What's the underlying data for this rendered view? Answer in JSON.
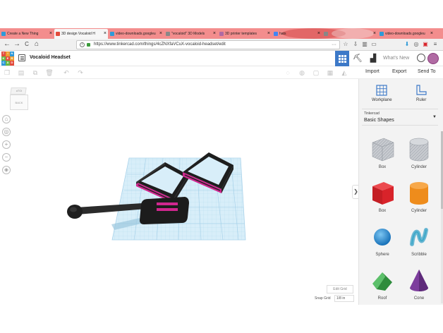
{
  "browser": {
    "tabs": [
      {
        "title": "Create a New Thing",
        "active": false
      },
      {
        "title": "3D design Vocaloid H",
        "active": true
      },
      {
        "title": "video-downloads.googleu",
        "active": false
      },
      {
        "title": "\"vocaloid\" 3D Models",
        "active": false
      },
      {
        "title": "3D printer templates",
        "active": false
      },
      {
        "title": "hats",
        "active": false
      },
      {
        "title": "",
        "active": false
      },
      {
        "title": "video-downloads.googleu",
        "active": false
      }
    ],
    "url": "https://www.tinkercad.com/things/4cZNXfaVCuX-vocaloid-headset/edit",
    "nav": {
      "back": "←",
      "forward": "→",
      "reload": "C",
      "home": "⌂"
    }
  },
  "app": {
    "logo_letters": [
      "T",
      "I",
      "N",
      "K",
      "E",
      "R",
      "C",
      "A",
      "D"
    ],
    "logo_colors": [
      "#e24b3c",
      "#f09d2e",
      "#2f9ad8",
      "#68b944",
      "#e24b3c",
      "#f09d2e",
      "#2f9ad8",
      "#68b944",
      "#e24b3c"
    ],
    "design_title": "Vocaloid Headset",
    "whats_new": "What's New"
  },
  "toolbar": {
    "import": "Import",
    "export": "Export",
    "send_to": "Send To"
  },
  "viewcube": {
    "top": "aTOi",
    "front": "BACK"
  },
  "workplane": {
    "edit_grid": "Edit Grid",
    "snap_grid_label": "Snap Grid",
    "snap_grid_value": "1/8 in"
  },
  "panel": {
    "workplane_label": "Workplane",
    "ruler_label": "Ruler",
    "library_category": "Tinkercad",
    "library_name": "Basic Shapes",
    "shapes": [
      {
        "label": "Box",
        "icon": "box-hole-icon"
      },
      {
        "label": "Cylinder",
        "icon": "cylinder-hole-icon"
      },
      {
        "label": "Box",
        "icon": "box-icon"
      },
      {
        "label": "Cylinder",
        "icon": "cylinder-icon"
      },
      {
        "label": "Sphere",
        "icon": "sphere-icon"
      },
      {
        "label": "Scribble",
        "icon": "scribble-icon"
      },
      {
        "label": "Roof",
        "icon": "roof-icon"
      },
      {
        "label": "Cone",
        "icon": "cone-icon"
      }
    ]
  },
  "colors": {
    "accent": "#3d79c8",
    "grid": "#cce6f4",
    "shape_red": "#d8232a",
    "shape_orange": "#ee8c1c",
    "shape_blue": "#2b8fd6",
    "shape_teal": "#3fa9c9",
    "shape_green": "#3ca34a",
    "shape_purple": "#7d3d9d",
    "model_black": "#222222",
    "model_magenta": "#d0278f"
  }
}
